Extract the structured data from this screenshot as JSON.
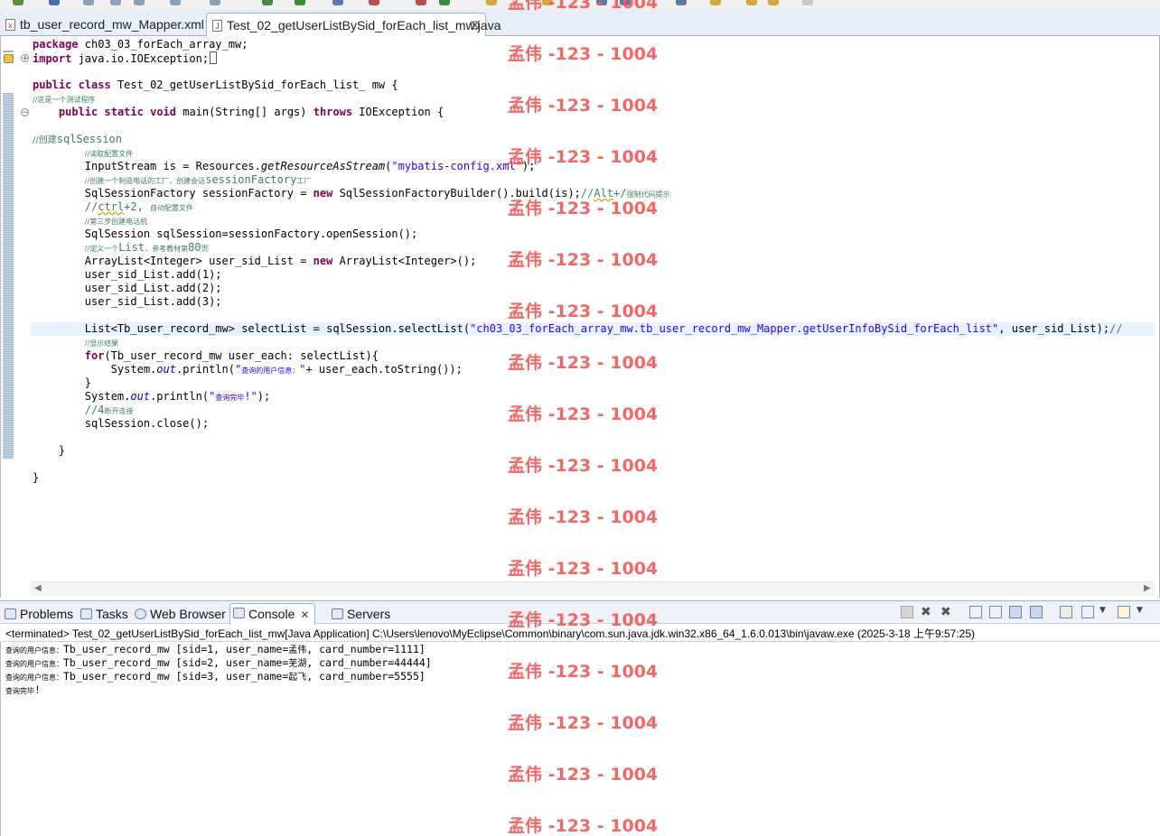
{
  "editor_tabs": [
    {
      "label": "tb_user_record_mw_Mapper.xml",
      "icon": "xml-file-icon",
      "active": false
    },
    {
      "label": "Test_02_getUserListBySid_forEach_list_mw.java",
      "icon": "java-file-icon",
      "active": true,
      "close": "⊠"
    }
  ],
  "code": {
    "l1_kw": "package",
    "l1_rest": " ch03_03_forEach_array_mw;",
    "l2_kw": "import",
    "l2_rest": " java.io.IOException;",
    "l4_kw1": "public",
    "l4_kw2": "class",
    "l4_rest": " Test_02_getUserListBySid_forEach_list_ mw {",
    "l5_cm": "//这是一个测试程序",
    "l6_kw1": "public",
    "l6_kw2": "static",
    "l6_kw3": "void",
    "l6_mid": " main(String[] args) ",
    "l6_kw4": "throws",
    "l6_rest": " IOException {",
    "l8_cm1": "//创建",
    "l8_cm2": "sqlSession",
    "l9_cm": "//读取配置文件",
    "l10_a": "InputStream is = Resources.",
    "l10_b": "getResourceAsStream",
    "l10_c": "(",
    "l10_str": "\"mybatis-config.xml\"",
    "l10_d": ");",
    "l11_cm1": "//创建一个制造电话的工厂，创建会话",
    "l11_cm2": "sessionFactory",
    "l11_cm3": "工厂",
    "l12_a": "SqlSessionFactory sessionFactory = ",
    "l12_kw": "new",
    "l12_b": " SqlSessionFactoryBuilder().build(is);",
    "l12_cm1": "//",
    "l12_cm2": "Alt",
    "l12_cm3": "+/",
    "l12_cm4": "强制代码提示",
    "l13_cm1": "//",
    "l13_cm2": "ctrl",
    "l13_cm3": "+2, ",
    "l13_cm4": "自动配置文件",
    "l14_cm": "//第三步创建电话机",
    "l15": "SqlSession sqlSession=sessionFactory.openSession();",
    "l16_cm1": "//定义一个",
    "l16_cm2": "List",
    "l16_cm3": "，参考教材第",
    "l16_cm4": "80",
    "l16_cm5": "页",
    "l17_a": "ArrayList<Integer> user_sid_List = ",
    "l17_kw": "new",
    "l17_b": " ArrayList<Integer>();",
    "l18": "user_sid_List.add(1);",
    "l19": "user_sid_List.add(2);",
    "l20": "user_sid_List.add(3);",
    "l22_a": "List<Tb_user_record_mw> selectList = sqlSession.selectList(",
    "l22_str": "\"ch03_03_forEach_array_mw.tb_user_record_mw_Mapper.getUserInfoBySid_forEach_list\"",
    "l22_b": ", user_sid_List);",
    "l22_cm": "//",
    "l23_cm": "//显示结果",
    "l24_kw": "for",
    "l24_rest": "(Tb_user_record_mw user_each: selectList){",
    "l25_a": "System.",
    "l25_out": "out",
    "l25_b": ".println(",
    "l25_str1": "\"",
    "l25_strcn": "查询的用户信息：",
    "l25_str2": "\"",
    "l25_c": "+ user_each.toString());",
    "l26": "}",
    "l27_a": "System.",
    "l27_out": "out",
    "l27_b": ".println(",
    "l27_str1": "\"",
    "l27_strcn": "查询完毕",
    "l27_str2": "!\"",
    "l27_c": ");",
    "l28_cm1": "//",
    "l28_cm2": "4",
    "l28_cm3": "断开连接",
    "l29": "sqlSession.close();",
    "l31": "}",
    "l33": "}"
  },
  "bottom_tabs": [
    {
      "label": "Problems",
      "icon": "problems-icon"
    },
    {
      "label": "Tasks",
      "icon": "tasks-icon"
    },
    {
      "label": "Web Browser",
      "icon": "globe-icon"
    },
    {
      "label": "Console",
      "icon": "console-icon",
      "close": "✕"
    },
    {
      "label": "Servers",
      "icon": "servers-icon"
    }
  ],
  "console": {
    "header": "<terminated> Test_02_getUserListBySid_forEach_list_mw[Java Application] C:\\Users\\lenovo\\MyEclipse\\Common\\binary\\com.sun.java.jdk.win32.x86_64_1.6.0.013\\bin\\javaw.exe (2025-3-18 上午9:57:25)",
    "lines": [
      {
        "prefix": "查询的用户信息：",
        "a": "Tb_user_record_mw [sid=1, user_name=",
        "name": "孟伟",
        "b": ", card_number=1111]"
      },
      {
        "prefix": "查询的用户信息：",
        "a": "Tb_user_record_mw [sid=2, user_name=",
        "name": "芜湖",
        "b": ", card_number=44444]"
      },
      {
        "prefix": "查询的用户信息：",
        "a": "Tb_user_record_mw [sid=3, user_name=",
        "name": "起飞",
        "b": ", card_number=5555]"
      }
    ],
    "done_cn": "查询完毕",
    "done_bang": "!"
  },
  "watermark": "孟伟 -123 - 1004",
  "colors": {
    "keyword": "#7f0055",
    "comment": "#3f7f5f",
    "string": "#2a00ff",
    "field": "#0000c0",
    "watermark": "#f25a5a"
  }
}
